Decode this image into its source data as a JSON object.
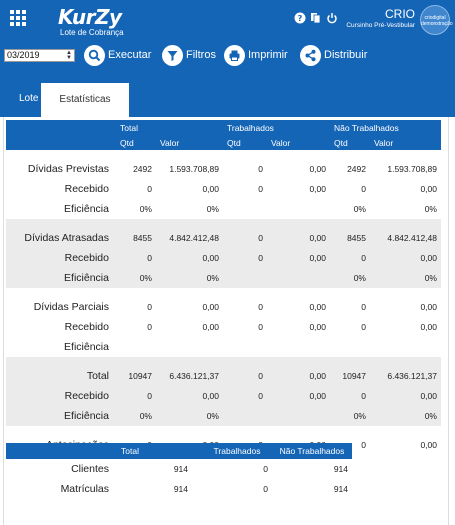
{
  "header": {
    "logo": "KurZy",
    "logo_sub": "Lote de Cobrança",
    "client_name": "CRIO",
    "client_sub": "Cursinho Pré-Vestibular",
    "avatar_text": "criodigital demonstração"
  },
  "toolbar": {
    "period": "03/2019",
    "executar": "Executar",
    "filtros": "Filtros",
    "imprimir": "Imprimir",
    "distribuir": "Distribuir"
  },
  "tabs": [
    "Lote",
    "Estatísticas"
  ],
  "stats_table": {
    "groups": [
      "Total",
      "Trabalhados",
      "Não Trabalhados"
    ],
    "subheaders": [
      "Qtd",
      "Valor",
      "Qtd",
      "Valor",
      "Qtd",
      "Valor"
    ],
    "rows": [
      {
        "label": "Dívidas Previstas",
        "values": [
          "2492",
          "1.593.708,89",
          "0",
          "0,00",
          "2492",
          "1.593.708,89"
        ]
      },
      {
        "label": "Recebido",
        "values": [
          "0",
          "0,00",
          "0",
          "0,00",
          "0",
          "0,00"
        ]
      },
      {
        "label": "Eficiência",
        "values": [
          "0%",
          "0%",
          "",
          "",
          "0%",
          "0%"
        ]
      },
      {
        "label": "Dívidas Atrasadas",
        "values": [
          "8455",
          "4.842.412,48",
          "0",
          "0,00",
          "8455",
          "4.842.412,48"
        ]
      },
      {
        "label": "Recebido",
        "values": [
          "0",
          "0,00",
          "0",
          "0,00",
          "0",
          "0,00"
        ]
      },
      {
        "label": "Eficiência",
        "values": [
          "0%",
          "0%",
          "",
          "",
          "0%",
          "0%"
        ]
      },
      {
        "label": "Dívidas Parciais",
        "values": [
          "0",
          "0,00",
          "0",
          "0,00",
          "0",
          "0,00"
        ]
      },
      {
        "label": "Recebido",
        "values": [
          "0",
          "0,00",
          "0",
          "0,00",
          "0",
          "0,00"
        ]
      },
      {
        "label": "Eficiência",
        "values": [
          "",
          "",
          "",
          "",
          "",
          ""
        ]
      },
      {
        "label": "Total",
        "values": [
          "10947",
          "6.436.121,37",
          "0",
          "0,00",
          "10947",
          "6.436.121,37"
        ]
      },
      {
        "label": "Recebido",
        "values": [
          "0",
          "0,00",
          "0",
          "0,00",
          "0",
          "0,00"
        ]
      },
      {
        "label": "Eficiência",
        "values": [
          "0%",
          "0%",
          "",
          "",
          "0%",
          "0%"
        ]
      },
      {
        "label": "Antecipações",
        "values": [
          "0",
          "0,00",
          "0",
          "0,00",
          "0",
          "0,00"
        ]
      }
    ]
  },
  "summary_table": {
    "headers": [
      "Total",
      "Trabalhados",
      "Não Trabalhados"
    ],
    "rows": [
      {
        "label": "Clientes",
        "values": [
          "914",
          "0",
          "914"
        ]
      },
      {
        "label": "Matrículas",
        "values": [
          "914",
          "0",
          "914"
        ]
      }
    ]
  }
}
